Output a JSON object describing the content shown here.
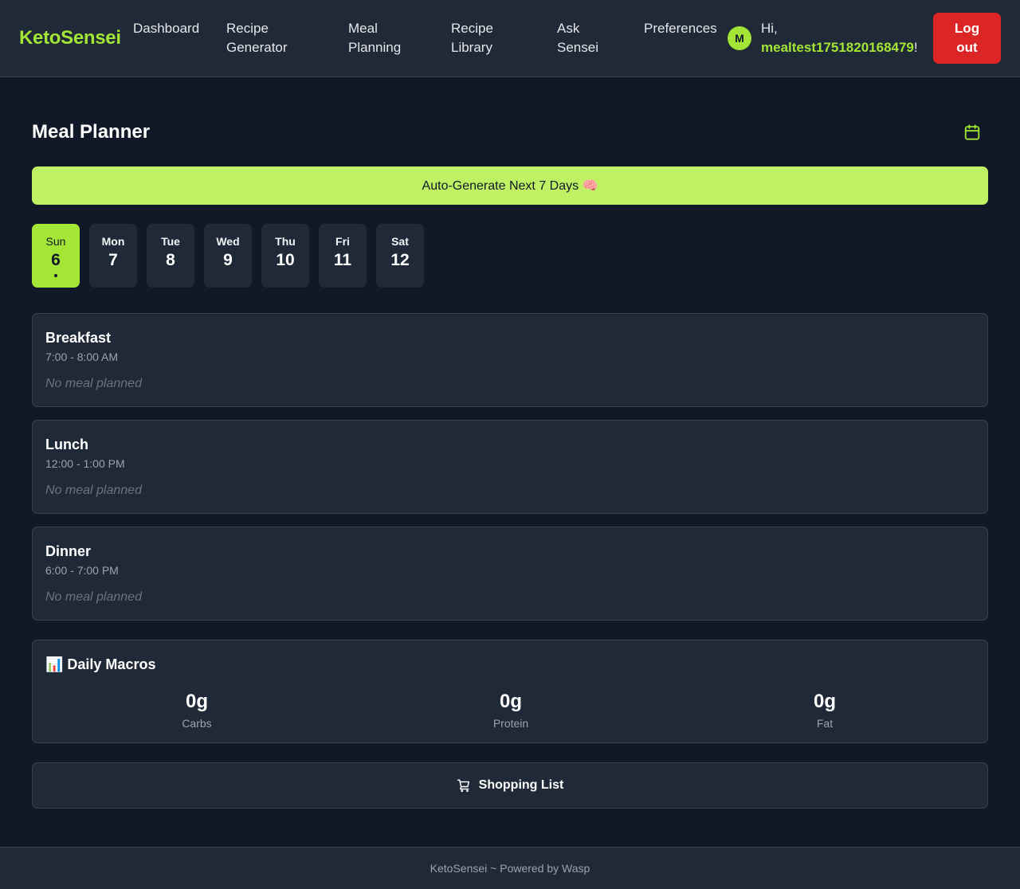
{
  "header": {
    "brand": "KetoSensei",
    "nav": [
      {
        "line1": "Dashboard",
        "line2": ""
      },
      {
        "line1": "Recipe",
        "line2": "Generator"
      },
      {
        "line1": "Meal",
        "line2": "Planning"
      },
      {
        "line1": "Recipe",
        "line2": "Library"
      },
      {
        "line1": "Ask",
        "line2": "Sensei"
      },
      {
        "line1": "Preferences",
        "line2": ""
      }
    ],
    "avatar_initial": "M",
    "greeting_prefix": "Hi,",
    "username": "mealtest1751820168479",
    "greeting_suffix": "!",
    "logout_line1": "Log",
    "logout_line2": "out"
  },
  "main": {
    "title": "Meal Planner",
    "autogen_label": "Auto-Generate Next 7 Days 🧠",
    "days": [
      {
        "name": "Sun",
        "num": "6"
      },
      {
        "name": "Mon",
        "num": "7"
      },
      {
        "name": "Tue",
        "num": "8"
      },
      {
        "name": "Wed",
        "num": "9"
      },
      {
        "name": "Thu",
        "num": "10"
      },
      {
        "name": "Fri",
        "num": "11"
      },
      {
        "name": "Sat",
        "num": "12"
      }
    ],
    "selected_day": "Sun",
    "meals": [
      {
        "title": "Breakfast",
        "time": "7:00 - 8:00 AM",
        "empty": "No meal planned"
      },
      {
        "title": "Lunch",
        "time": "12:00 - 1:00 PM",
        "empty": "No meal planned"
      },
      {
        "title": "Dinner",
        "time": "6:00 - 7:00 PM",
        "empty": "No meal planned"
      }
    ],
    "macros": {
      "title": "📊 Daily Macros",
      "items": [
        {
          "value": "0g",
          "label": "Carbs"
        },
        {
          "value": "0g",
          "label": "Protein"
        },
        {
          "value": "0g",
          "label": "Fat"
        }
      ]
    },
    "shopping_label": "Shopping List"
  },
  "footer": {
    "text": "KetoSensei ~ Powered by Wasp"
  },
  "colors": {
    "accent": "#a3e635",
    "autogen_bg": "#bef264",
    "logout": "#dc2626",
    "background": "#111827",
    "card": "#1f2937"
  },
  "icons": {
    "calendar": "calendar-icon",
    "shopping": "shopping-cart-icon"
  }
}
